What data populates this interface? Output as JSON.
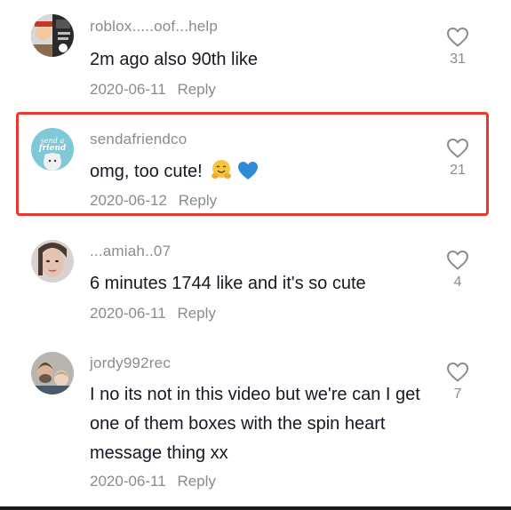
{
  "colors": {
    "highlight": "#e8382f",
    "muted": "#8a8b91",
    "text": "#161823"
  },
  "comments": [
    {
      "username": "roblox.....oof...help",
      "text": "2m ago also 90th like",
      "date": "2020-06-11",
      "reply_label": "Reply",
      "likes": "31",
      "avatar": "roblox-avatar"
    },
    {
      "username": "sendafriendco",
      "text": "omg, too cute!",
      "emojis": [
        "hugging-face-emoji",
        "blue-heart-emoji"
      ],
      "date": "2020-06-12",
      "reply_label": "Reply",
      "likes": "21",
      "avatar": "sendafriend-logo-avatar",
      "highlighted": true
    },
    {
      "username": "...amiah..07",
      "text": "6 minutes 1744 like and it's so cute",
      "date": "2020-06-11",
      "reply_label": "Reply",
      "likes": "4",
      "avatar": "user-photo-avatar"
    },
    {
      "username": "jordy992rec",
      "text": "I no its not in this video but we're can I get one of them boxes with the spin heart message thing xx",
      "date": "2020-06-11",
      "reply_label": "Reply",
      "likes": "7",
      "avatar": "user-photo-avatar"
    }
  ]
}
